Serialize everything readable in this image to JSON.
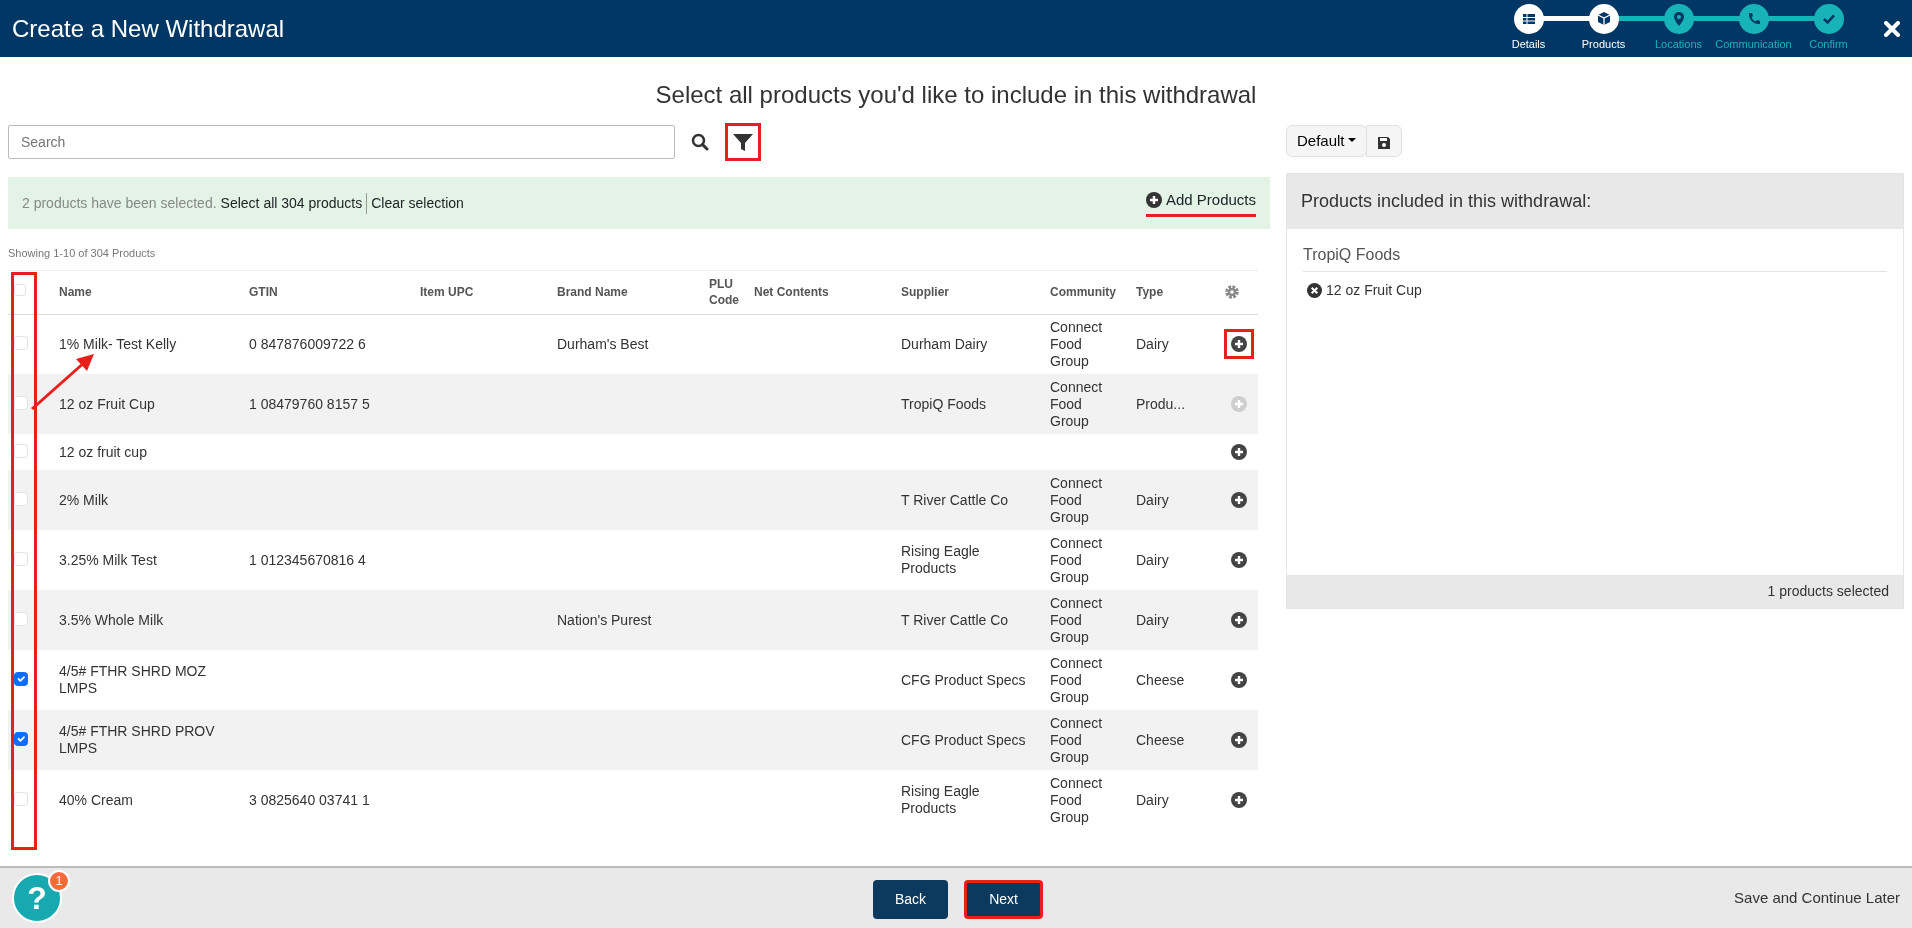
{
  "window": {
    "title": "Create a New Withdrawal"
  },
  "steps": [
    {
      "label": "Details",
      "reached": true
    },
    {
      "label": "Products",
      "reached": true
    },
    {
      "label": "Locations",
      "reached": false
    },
    {
      "label": "Communication",
      "reached": false
    },
    {
      "label": "Confirm",
      "reached": false
    }
  ],
  "heading": "Select all products you'd like to include in this withdrawal",
  "search": {
    "placeholder": "Search"
  },
  "filter_button": {
    "highlighted": true
  },
  "view_select": {
    "value": "Default"
  },
  "selection_bar": {
    "message": "2 products have been selected.",
    "select_all": "Select all 304 products",
    "clear": "Clear selection",
    "add_products": "Add Products",
    "add_products_underlined": true
  },
  "annotations": {
    "checkbox_column_frame": true,
    "arrow_to_selection": true
  },
  "showing": "Showing 1-10 of 304 Products",
  "table": {
    "columns": [
      "Name",
      "GTIN",
      "Item UPC",
      "Brand Name",
      "PLU Code",
      "Net Contents",
      "Supplier",
      "Community",
      "Type"
    ],
    "select_all_checked": false,
    "rows": [
      {
        "checked": false,
        "cells": [
          "1% Milk- Test Kelly",
          "0 847876009722 6",
          "",
          "Durham's Best",
          "",
          "",
          "Durham Dairy",
          "Connect Food Group",
          "Dairy"
        ],
        "add_disabled": false,
        "highlighted": true
      },
      {
        "checked": false,
        "cells": [
          "12 oz Fruit Cup",
          "1 08479760 8157 5",
          "",
          "",
          "",
          "",
          "TropiQ Foods",
          "Connect Food Group",
          "Produ..."
        ],
        "add_disabled": true,
        "highlighted": false
      },
      {
        "checked": false,
        "cells": [
          "12 oz fruit cup",
          "",
          "",
          "",
          "",
          "",
          "",
          "",
          ""
        ],
        "add_disabled": false,
        "highlighted": false
      },
      {
        "checked": false,
        "cells": [
          "2% Milk",
          "",
          "",
          "",
          "",
          "",
          "T River Cattle Co",
          "Connect Food Group",
          "Dairy"
        ],
        "add_disabled": false,
        "highlighted": false
      },
      {
        "checked": false,
        "cells": [
          "3.25% Milk Test",
          "1 012345670816 4",
          "",
          "",
          "",
          "",
          "Rising Eagle Products",
          "Connect Food Group",
          "Dairy"
        ],
        "add_disabled": false,
        "highlighted": false
      },
      {
        "checked": false,
        "cells": [
          "3.5% Whole Milk",
          "",
          "",
          "Nation's Purest",
          "",
          "",
          "T River Cattle Co",
          "Connect Food Group",
          "Dairy"
        ],
        "add_disabled": false,
        "highlighted": false
      },
      {
        "checked": true,
        "cells": [
          "4/5# FTHR SHRD MOZ LMPS",
          "",
          "",
          "",
          "",
          "",
          "CFG Product Specs",
          "Connect Food Group",
          "Cheese"
        ],
        "add_disabled": false,
        "highlighted": false
      },
      {
        "checked": true,
        "cells": [
          "4/5# FTHR SHRD PROV LMPS",
          "",
          "",
          "",
          "",
          "",
          "CFG Product Specs",
          "Connect Food Group",
          "Cheese"
        ],
        "add_disabled": false,
        "highlighted": false
      },
      {
        "checked": false,
        "cells": [
          "40% Cream",
          "3 0825640 03741 1",
          "",
          "",
          "",
          "",
          "Rising Eagle Products",
          "Connect Food Group",
          "Dairy"
        ],
        "add_disabled": false,
        "highlighted": false
      }
    ]
  },
  "panel": {
    "title": "Products included in this withdrawal:",
    "groups": [
      {
        "name": "TropiQ Foods",
        "items": [
          "12 oz Fruit Cup"
        ]
      }
    ],
    "footer": "1 products selected"
  },
  "help": {
    "label": "?",
    "badge": "1"
  },
  "back_button": {
    "label": "Back"
  },
  "next_button": {
    "label": "Next",
    "highlighted": true
  },
  "save_later": "Save and Continue Later"
}
